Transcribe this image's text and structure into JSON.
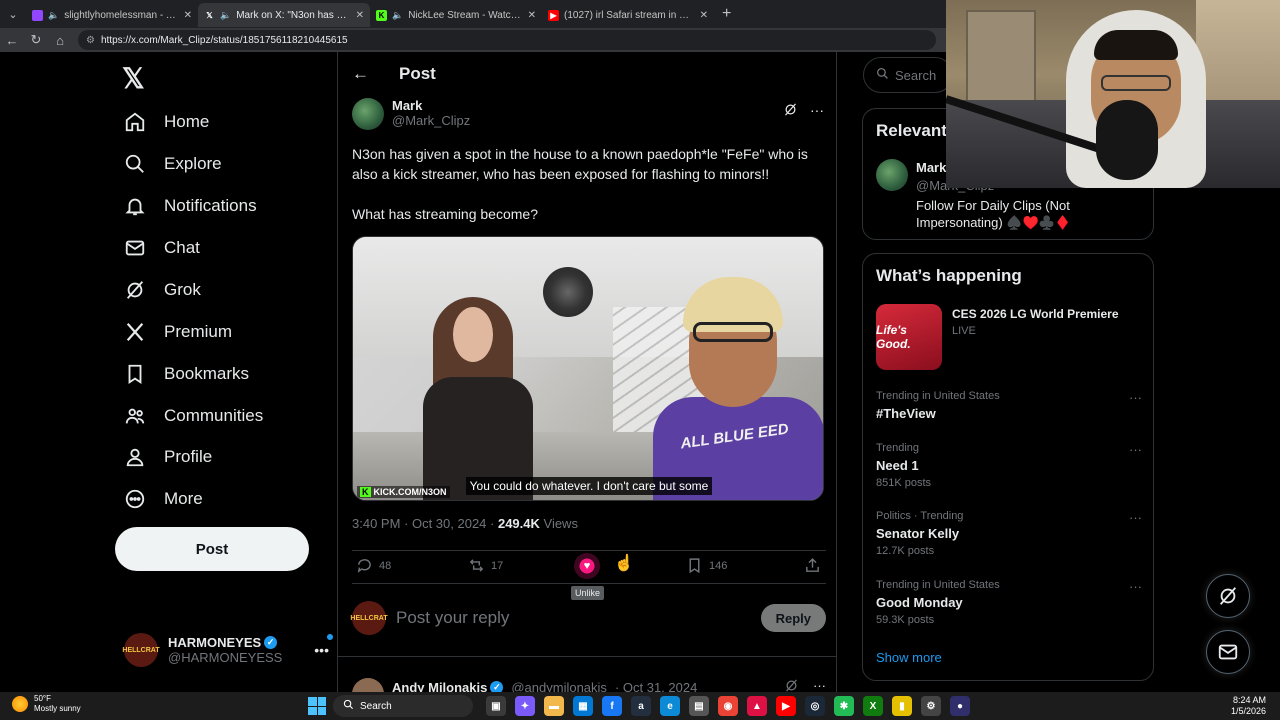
{
  "browser": {
    "tabs": [
      {
        "title": "slightlyhomelessman - Twitch",
        "color": "#9146ff",
        "active": false
      },
      {
        "title": "Mark on X: \"N3on has given a",
        "color": "#000000",
        "active": true
      },
      {
        "title": "NickLee Stream - Watch Live o",
        "color": "#53fc18",
        "active": false
      },
      {
        "title": "(1027) irl Safari stream in Okla",
        "color": "#ff0000",
        "active": false
      }
    ],
    "url": "https://x.com/Mark_Clipz/status/1851756118210445615"
  },
  "nav": {
    "items": [
      {
        "label": "Home",
        "icon": "home-icon"
      },
      {
        "label": "Explore",
        "icon": "search-icon"
      },
      {
        "label": "Notifications",
        "icon": "bell-icon"
      },
      {
        "label": "Chat",
        "icon": "mail-icon"
      },
      {
        "label": "Grok",
        "icon": "grok-icon"
      },
      {
        "label": "Premium",
        "icon": "x-icon"
      },
      {
        "label": "Bookmarks",
        "icon": "bookmark-icon"
      },
      {
        "label": "Communities",
        "icon": "communities-icon"
      },
      {
        "label": "Profile",
        "icon": "profile-icon"
      },
      {
        "label": "More",
        "icon": "more-icon"
      }
    ],
    "post_label": "Post",
    "account": {
      "name": "HARMONEYES",
      "handle": "@HARMONEYESS",
      "avatar_text": "HELLCRAT"
    }
  },
  "post": {
    "header": "Post",
    "author_name": "Mark",
    "author_handle": "@Mark_Clipz",
    "text": "N3on has given a spot in the house to a known paedoph*le \"FeFe\" who is also a kick streamer, who has been exposed for flashing to minors!!\n\nWhat has streaming become?",
    "media": {
      "caption": "You could do whatever. I don't care but some",
      "watermark": "KICK.COM/N3ON",
      "shirt_text": "ALL BLUE EED"
    },
    "time": "3:40 PM · Oct 30, 2024 · ",
    "views_count": "249.4K",
    "views_label": " Views",
    "replies": "48",
    "reposts": "17",
    "bookmarks": "146",
    "like_tooltip": "Unlike",
    "like_color": "#f91880"
  },
  "reply_box": {
    "placeholder": "Post your reply",
    "button": "Reply",
    "avatar_text": "HELLCRAT"
  },
  "next_reply": {
    "name": "Andy Milonakis",
    "handle": "@andymilonakis",
    "date": "· Oct 31, 2024"
  },
  "sidebar": {
    "search_placeholder": "Search",
    "relevant": {
      "title": "Relevant",
      "name": "Mark",
      "handle": "@Mark_Clipz",
      "bio": "Follow For Daily Clips (Not Impersonating) ♠️♥️♣️♦️"
    },
    "happening": {
      "title": "What’s happening",
      "event": {
        "name": "CES 2026 LG World Premiere",
        "status": "LIVE",
        "thumb_text": "Life's Good."
      },
      "trends": [
        {
          "context": "Trending in United States",
          "name": "#TheView",
          "count": ""
        },
        {
          "context": "Trending",
          "name": "Need 1",
          "count": "851K posts"
        },
        {
          "context": "Politics · Trending",
          "name": "Senator Kelly",
          "count": "12.7K posts"
        },
        {
          "context": "Trending in United States",
          "name": "Good Monday",
          "count": "59.3K posts"
        }
      ],
      "show_more": "Show more"
    }
  },
  "taskbar": {
    "weather_temp": "50°F",
    "weather_desc": "Mostly sunny",
    "search_label": "Search",
    "time": "8:24 AM",
    "date": "1/5/2026"
  }
}
